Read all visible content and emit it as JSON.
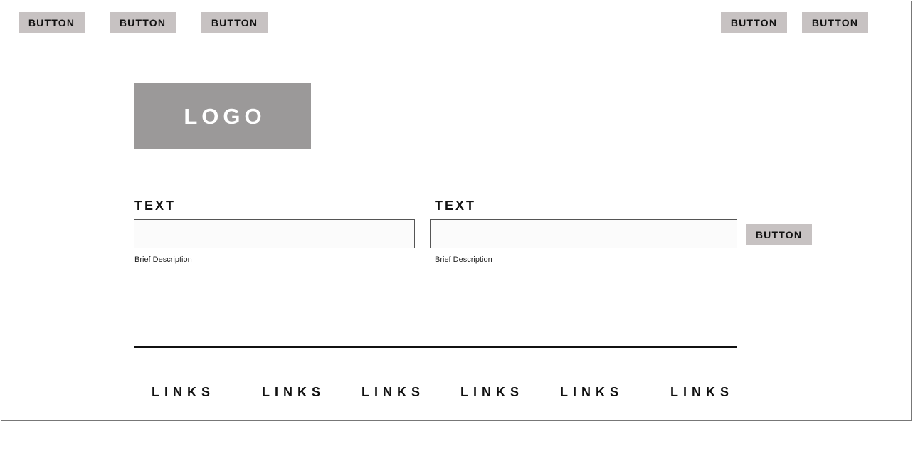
{
  "top_nav": {
    "left_buttons": [
      "BUTTON",
      "BUTTON",
      "BUTTON"
    ],
    "right_buttons": [
      "BUTTON",
      "BUTTON"
    ]
  },
  "logo": {
    "text": "LOGO"
  },
  "form": {
    "fields": [
      {
        "label": "TEXT",
        "value": "",
        "placeholder": "",
        "description": "Brief Description"
      },
      {
        "label": "TEXT",
        "value": "",
        "placeholder": "",
        "description": "Brief Description"
      }
    ],
    "submit_label": "BUTTON"
  },
  "footer": {
    "links": [
      "LINKS",
      "LINKS",
      "LINKS",
      "LINKS",
      "LINKS",
      "LINKS"
    ]
  },
  "colors": {
    "button_bg": "#c7c2c2",
    "logo_bg": "#9b9999",
    "logo_text": "#ffffff",
    "border": "#777777",
    "text": "#111111"
  }
}
